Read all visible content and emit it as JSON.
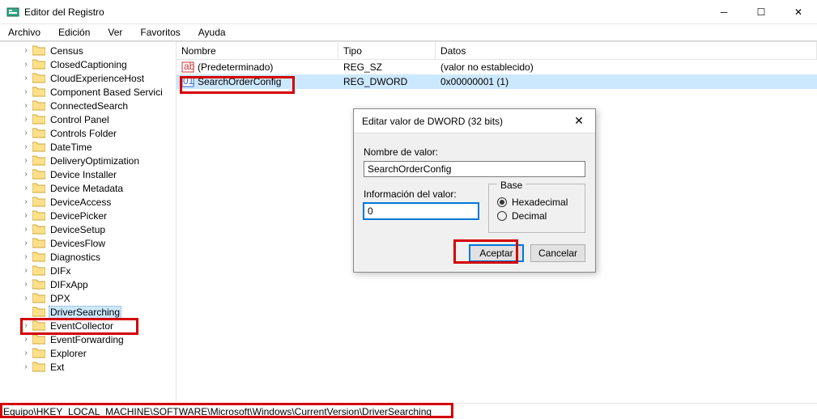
{
  "window": {
    "title": "Editor del Registro"
  },
  "menu": {
    "file": "Archivo",
    "edit": "Edición",
    "view": "Ver",
    "favorites": "Favoritos",
    "help": "Ayuda"
  },
  "tree": {
    "items": [
      "Census",
      "ClosedCaptioning",
      "CloudExperienceHost",
      "Component Based Servici",
      "ConnectedSearch",
      "Control Panel",
      "Controls Folder",
      "DateTime",
      "DeliveryOptimization",
      "Device Installer",
      "Device Metadata",
      "DeviceAccess",
      "DevicePicker",
      "DeviceSetup",
      "DevicesFlow",
      "Diagnostics",
      "DIFx",
      "DIFxApp",
      "DPX",
      "DriverSearching",
      "EventCollector",
      "EventForwarding",
      "Explorer",
      "Ext"
    ],
    "selected_index": 19
  },
  "list": {
    "headers": {
      "name": "Nombre",
      "type": "Tipo",
      "data": "Datos"
    },
    "rows": [
      {
        "name": "(Predeterminado)",
        "type": "REG_SZ",
        "data": "(valor no establecido)",
        "kind": "sz"
      },
      {
        "name": "SearchOrderConfig",
        "type": "REG_DWORD",
        "data": "0x00000001 (1)",
        "kind": "dword"
      }
    ],
    "selected_index": 1
  },
  "dialog": {
    "title": "Editar valor de DWORD (32 bits)",
    "name_label": "Nombre de valor:",
    "name_value": "SearchOrderConfig",
    "data_label": "Información del valor:",
    "data_value": "0",
    "base_label": "Base",
    "hex": "Hexadecimal",
    "dec": "Decimal",
    "base_selected": "hex",
    "ok": "Aceptar",
    "cancel": "Cancelar"
  },
  "status": {
    "path": "Equipo\\HKEY_LOCAL_MACHINE\\SOFTWARE\\Microsoft\\Windows\\CurrentVersion\\DriverSearching"
  }
}
